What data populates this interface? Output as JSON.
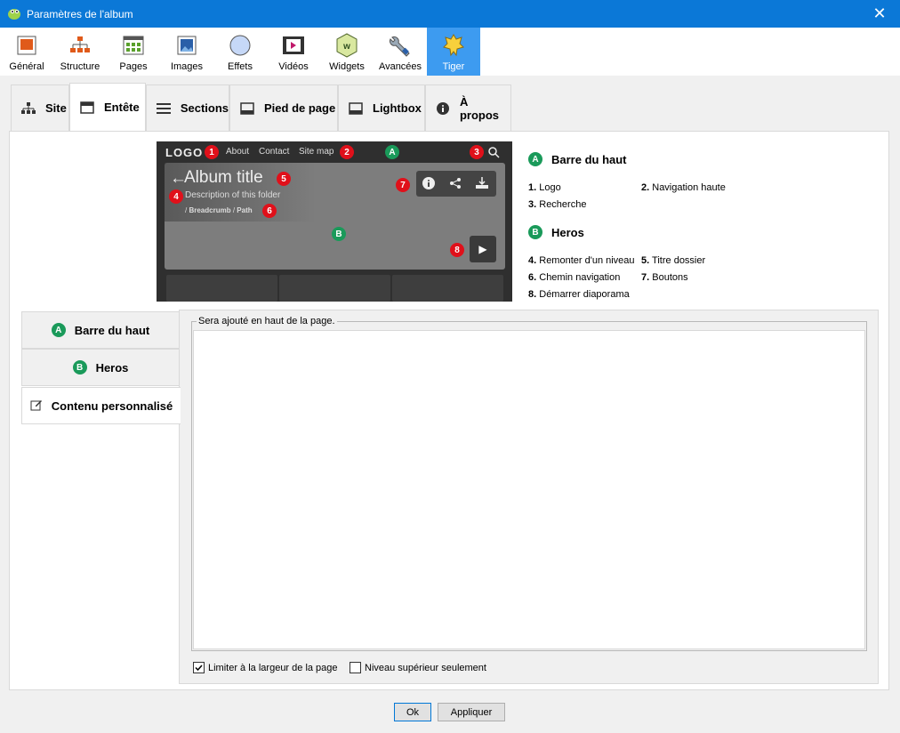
{
  "window": {
    "title": "Paramètres de l'album",
    "close_icon": "close-icon"
  },
  "toolbar": {
    "items": [
      {
        "label": "Général",
        "icon": "general-icon"
      },
      {
        "label": "Structure",
        "icon": "structure-icon"
      },
      {
        "label": "Pages",
        "icon": "pages-icon"
      },
      {
        "label": "Images",
        "icon": "images-icon"
      },
      {
        "label": "Effets",
        "icon": "effects-icon"
      },
      {
        "label": "Vidéos",
        "icon": "videos-icon"
      },
      {
        "label": "Widgets",
        "icon": "widgets-icon"
      },
      {
        "label": "Avancées",
        "icon": "advanced-icon"
      },
      {
        "label": "Tiger",
        "icon": "tiger-icon",
        "active": true
      }
    ]
  },
  "tabs": [
    {
      "label": "Site",
      "icon": "sitemap-icon"
    },
    {
      "label": "Entête",
      "icon": "header-icon",
      "active": true
    },
    {
      "label": "Sections",
      "icon": "list-icon"
    },
    {
      "label": "Pied de page",
      "icon": "footer-icon"
    },
    {
      "label": "Lightbox",
      "icon": "lightbox-icon"
    },
    {
      "label": "À propos",
      "icon": "info-icon"
    }
  ],
  "preview": {
    "logo": "LOGO",
    "nav_links": [
      "About",
      "Contact",
      "Site map"
    ],
    "album_title": "Album title",
    "description": "Description of this folder",
    "breadcrumb_sep": "/",
    "breadcrumb": "Breadcrumb",
    "path_sep": "/",
    "path": "Path",
    "markers": {
      "n1": "1",
      "n2": "2",
      "n3": "3",
      "n4": "4",
      "n5": "5",
      "n6": "6",
      "n7": "7",
      "n8": "8",
      "a": "A",
      "b": "B"
    }
  },
  "legend": {
    "top_bar": {
      "badge": "A",
      "title": "Barre du haut"
    },
    "top_items": [
      {
        "num": "1.",
        "text": "Logo"
      },
      {
        "num": "2.",
        "text": "Navigation haute"
      },
      {
        "num": "3.",
        "text": "Recherche"
      }
    ],
    "hero": {
      "badge": "B",
      "title": "Heros"
    },
    "hero_items": [
      {
        "num": "4.",
        "text": "Remonter d'un niveau"
      },
      {
        "num": "5.",
        "text": "Titre dossier"
      },
      {
        "num": "6.",
        "text": "Chemin navigation"
      },
      {
        "num": "7.",
        "text": "Boutons"
      },
      {
        "num": "8.",
        "text": "Démarrer diaporama"
      }
    ]
  },
  "sidebar": {
    "items": [
      {
        "badge": "A",
        "label": "Barre du haut"
      },
      {
        "badge": "B",
        "label": "Heros"
      },
      {
        "label": "Contenu personnalisé",
        "icon": "edit-icon",
        "active": true
      }
    ]
  },
  "content": {
    "group_label": "Sera ajouté en haut de la page.",
    "textarea_value": "",
    "limit_width_label": "Limiter à la largeur de la page",
    "limit_width_checked": true,
    "top_level_label": "Niveau supérieur seulement",
    "top_level_checked": false
  },
  "buttons": {
    "ok": "Ok",
    "apply": "Appliquer"
  },
  "colors": {
    "titlebar": "#0b78d7",
    "active_tool": "#3d9bf0",
    "badge_red": "#e0101a",
    "badge_green": "#1a9a5a"
  }
}
